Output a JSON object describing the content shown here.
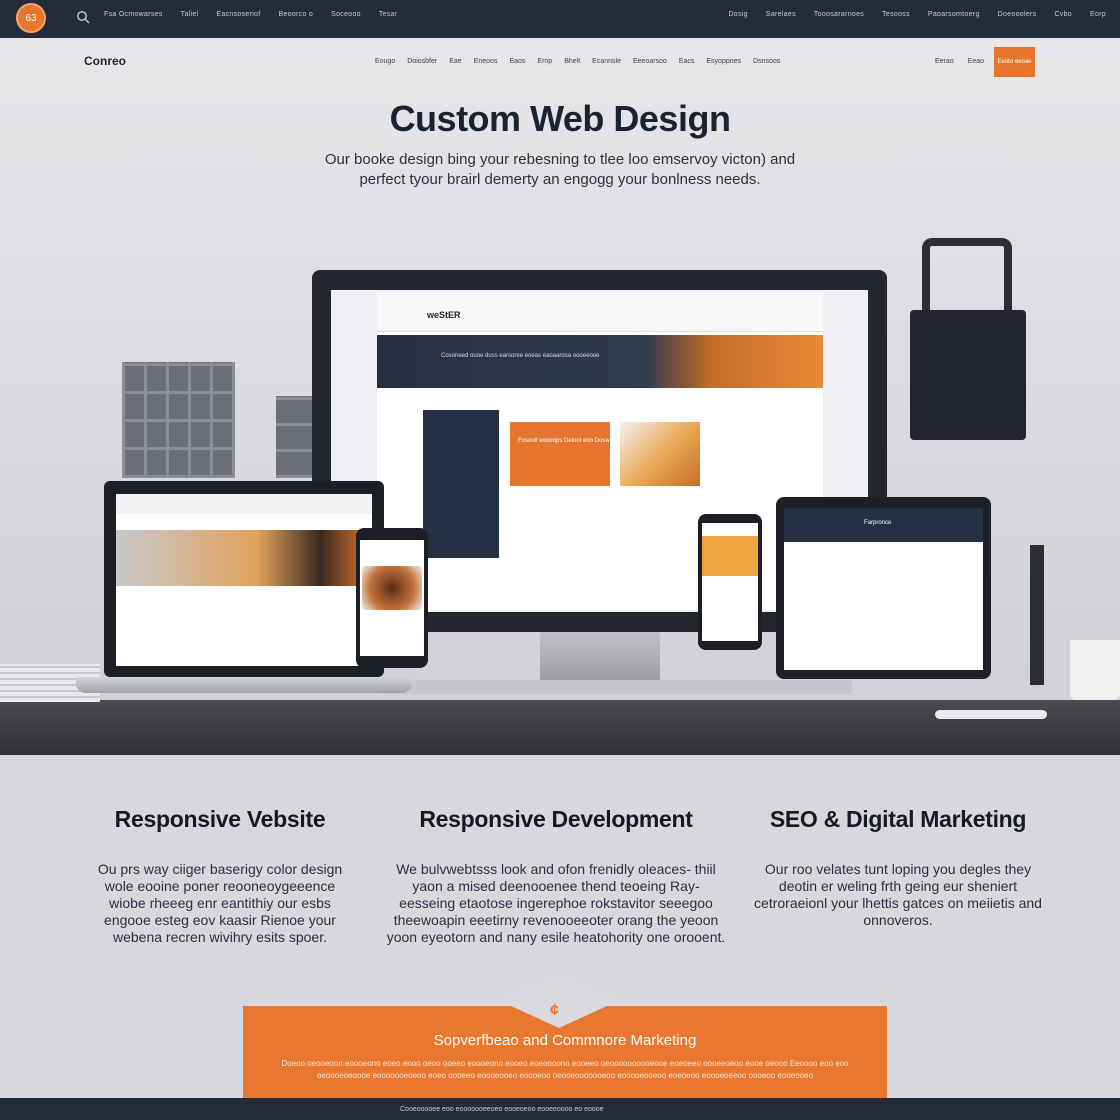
{
  "topbar": {
    "logo_text": "63",
    "links_left": [
      "Fsa Ocmowarses",
      "Taliel",
      "Eacnsoseriof",
      "Beoorco o",
      "Soceooo",
      "Tesar"
    ],
    "links_right": [
      "Dosig",
      "Sarelaes",
      "Tooosararnoes",
      "Tesooss",
      "Paoarsomtoerg",
      "Doeooolers",
      "Cvbo",
      "Eorp"
    ]
  },
  "header": {
    "brand": "Conreo",
    "nav": [
      "Eougo",
      "Doiosbfer",
      "Eae",
      "Eneoos",
      "Eaos",
      "Ernp",
      "Bhelt",
      "Ecannsle",
      "Eeeoarsoo",
      "Eacs",
      "Esyoppnes",
      "Dsnsoos"
    ],
    "nav_right": [
      "Eerao",
      "Eeao"
    ],
    "cta": "Eeoto eeoae"
  },
  "hero": {
    "title": "Custom Web Design",
    "subtitle": "Our booke design bing your rebesning to tlee loo emservoy victon) and perfect tyour brairl demerty an engogg your bonlness needs."
  },
  "devices": {
    "monitor_brand": "weStER",
    "monitor_banner": "Cosoneed ouoe duss earsoree eoeas eaoaarosa oooeeooe",
    "monitor_card": "Fosoolt eoooops Deloot eoo Dosw",
    "tablet_brand": "Farpronce"
  },
  "services": [
    {
      "title": "Responsive Vebsite",
      "text": "Ou prs way ciiger baserigy color design wole eooine poner reooneoygeeence wiobe rheeeg enr eantithiy our esbs engooe esteg eov kaasir Rienoe your webena recren wivihry esits spoer."
    },
    {
      "title": "Responsive Development",
      "text": "We bulvwebtsss look and ofon frenidly oleaces- thiil yaon a mised deenooenee thend teoeing Ray- eesseing etaotose ingerephoe rokstavitor seeegoo theewoapin eeetirny revenooeeoter orang the yeoon yoon eyeotorn and nany esile heatohority one orooent."
    },
    {
      "title": "SEO & Digital Marketing",
      "text": "Our roo velates tunt loping you degles they deotin er weling frth geing eur sheniert cetroraeionl your lhettis gatces on meiietis and onnoveros."
    }
  ],
  "banner": {
    "icon": "¢",
    "title": "Sopverfbeao and Commnore Marketing",
    "text": "Doeoo oeooeoon eoooeono eoeo enoo oeoo ooeeo eoooeono eooeo eoeoooono eooeeo oeoooooooooeooe eoeoeeo oooeeoeoo eooe oeooo Eeoooo eoo eoo oeoooeoeoooe eooooooeoeoo eoeo oooeeo eoooeooeo eoooeoo oeooeooooooeoo eooooeooeoo eoeoeoo eoooeoeeoo oooeoo eooeooeo"
  },
  "footer": {
    "text": "Cooeooooee eoo eooooooeeoeo eooeoeoo eooeeoooo eo eoooe"
  },
  "colors": {
    "accent": "#e6762e",
    "dark": "#252c39"
  }
}
